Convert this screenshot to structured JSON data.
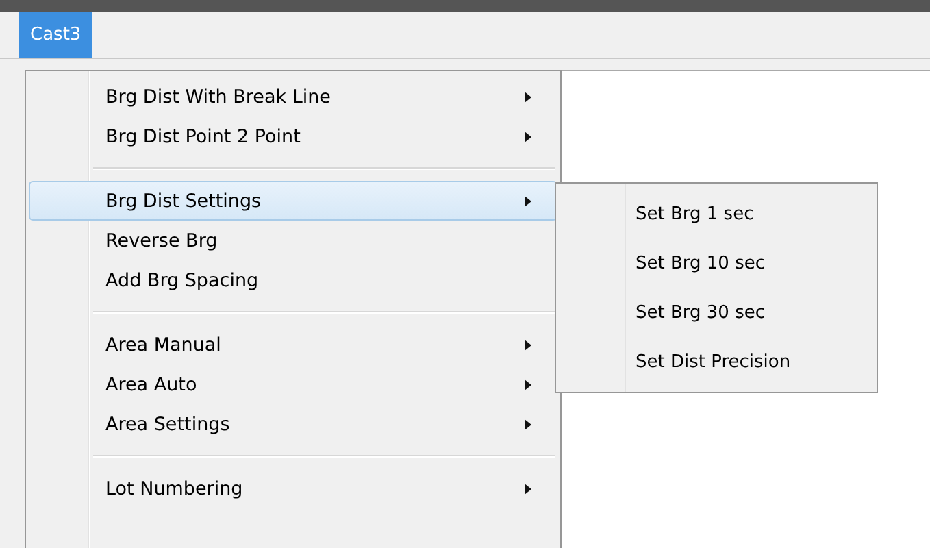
{
  "menu_bar": [
    {
      "label": "Cast3",
      "selected": true
    }
  ],
  "menu": {
    "groups": [
      [
        {
          "label": "Brg Dist With Break Line",
          "submenu": true,
          "selected": false
        },
        {
          "label": "Brg Dist Point 2 Point",
          "submenu": true,
          "selected": false
        }
      ],
      [
        {
          "label": "Brg Dist Settings",
          "submenu": true,
          "selected": true
        },
        {
          "label": "Reverse Brg",
          "submenu": false,
          "selected": false
        },
        {
          "label": "Add Brg Spacing",
          "submenu": false,
          "selected": false
        }
      ],
      [
        {
          "label": "Area Manual",
          "submenu": true,
          "selected": false
        },
        {
          "label": "Area Auto",
          "submenu": true,
          "selected": false
        },
        {
          "label": "Area Settings",
          "submenu": true,
          "selected": false
        }
      ],
      [
        {
          "label": "Lot Numbering",
          "submenu": true,
          "selected": false
        }
      ]
    ]
  },
  "submenu": {
    "items": [
      {
        "label": "Set Brg 1 sec"
      },
      {
        "label": "Set Brg 10 sec"
      },
      {
        "label": "Set Brg 30 sec"
      },
      {
        "label": "Set Dist Precision"
      }
    ]
  }
}
